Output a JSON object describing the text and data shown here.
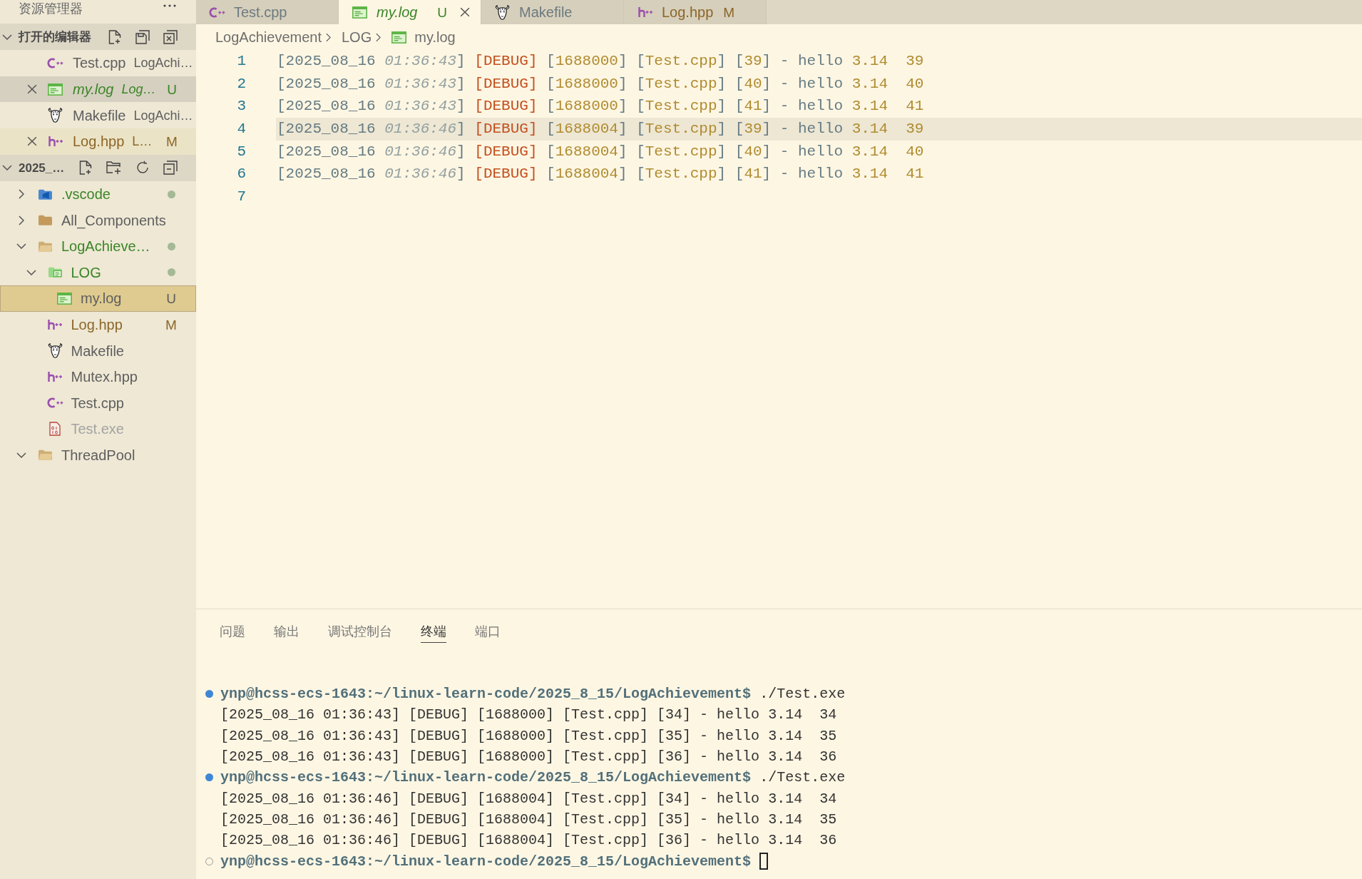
{
  "explorer": {
    "title": "资源管理器",
    "open_editors": {
      "title": "打开的编辑器",
      "expanded": true,
      "items": [
        {
          "kind": "cpp",
          "name": "Test.cpp",
          "description": "LogAchi…",
          "color": "#5e5e5e",
          "selected": false,
          "hovered": false,
          "preview": false
        },
        {
          "kind": "log",
          "name": "my.log",
          "description": "Log…",
          "badge": "U",
          "color": "#3b8527",
          "selected": true,
          "hovered": false,
          "preview": true
        },
        {
          "kind": "make",
          "name": "Makefile",
          "description": "LogAchi…",
          "color": "#5e5e5e",
          "selected": false,
          "hovered": false,
          "preview": false
        },
        {
          "kind": "hpp",
          "name": "Log.hpp",
          "description": "L…",
          "badge": "M",
          "color": "#8c6628",
          "selected": false,
          "hovered": true,
          "preview": false
        }
      ]
    },
    "folder": {
      "title": "2025_…",
      "expanded": true,
      "items": [
        {
          "kind": "vscode-folder",
          "name": ".vscode",
          "expanded": false,
          "color": "#3b8527",
          "dot": true,
          "selected": false
        },
        {
          "kind": "folder",
          "name": "All_Components",
          "expanded": false,
          "color": "#5e5e5e",
          "dot": false,
          "selected": false
        },
        {
          "kind": "folder",
          "name": "LogAchieve…",
          "expanded": true,
          "color": "#3b8527",
          "dot": true,
          "selected": false,
          "children": [
            {
              "kind": "log-folder",
              "name": "LOG",
              "expanded": true,
              "color": "#3b8527",
              "dot": true,
              "selected": false,
              "children": [
                {
                  "kind": "log",
                  "name": "my.log",
                  "badge": "U",
                  "selected": true
                }
              ]
            },
            {
              "kind": "hpp",
              "name": "Log.hpp",
              "badge": "M",
              "color": "#8c6628",
              "selected": false
            },
            {
              "kind": "make",
              "name": "Makefile",
              "color": "#5e5e5e",
              "selected": false
            },
            {
              "kind": "hpp",
              "name": "Mutex.hpp",
              "color": "#5e5e5e",
              "selected": false
            },
            {
              "kind": "cpp",
              "name": "Test.cpp",
              "color": "#5e5e5e",
              "selected": false
            },
            {
              "kind": "exe",
              "name": "Test.exe",
              "color": "#a3a3a3",
              "selected": false
            }
          ]
        },
        {
          "kind": "folder",
          "name": "ThreadPool",
          "expanded": true,
          "color": "#5e5e5e",
          "dot": false,
          "selected": false
        }
      ]
    }
  },
  "tabs": [
    {
      "kind": "cpp",
      "label": "Test.cpp",
      "color": "#6b7a80",
      "selected": false,
      "preview": false
    },
    {
      "kind": "log",
      "label": "my.log",
      "badge": "U",
      "color": "#3b8527",
      "selected": true,
      "preview": true
    },
    {
      "kind": "make",
      "label": "Makefile",
      "color": "#6b7a80",
      "selected": false,
      "preview": false
    },
    {
      "kind": "hpp",
      "label": "Log.hpp",
      "badge": "M",
      "color": "#8c6628",
      "selected": false,
      "preview": false
    }
  ],
  "breadcrumb": [
    {
      "kind": "folder",
      "label": "LogAchievement"
    },
    {
      "kind": "folder",
      "label": "LOG"
    },
    {
      "kind": "log",
      "label": "my.log"
    }
  ],
  "editor": {
    "lines": [
      {
        "number": "1",
        "current": false,
        "tokens": [
          {
            "kind": "text",
            "text": "[2025_08_16 "
          },
          {
            "kind": "time",
            "text": "01:36:43"
          },
          {
            "kind": "text",
            "text": "] "
          },
          {
            "kind": "level",
            "text": "[DEBUG]"
          },
          {
            "kind": "text",
            "text": " ["
          },
          {
            "kind": "value",
            "text": "1688000"
          },
          {
            "kind": "text",
            "text": "] ["
          },
          {
            "kind": "value",
            "text": "Test.cpp"
          },
          {
            "kind": "text",
            "text": "] ["
          },
          {
            "kind": "value",
            "text": "39"
          },
          {
            "kind": "text",
            "text": "] - hello "
          },
          {
            "kind": "value",
            "text": "3.14  39"
          }
        ]
      },
      {
        "number": "2",
        "current": false,
        "tokens": [
          {
            "kind": "text",
            "text": "[2025_08_16 "
          },
          {
            "kind": "time",
            "text": "01:36:43"
          },
          {
            "kind": "text",
            "text": "] "
          },
          {
            "kind": "level",
            "text": "[DEBUG]"
          },
          {
            "kind": "text",
            "text": " ["
          },
          {
            "kind": "value",
            "text": "1688000"
          },
          {
            "kind": "text",
            "text": "] ["
          },
          {
            "kind": "value",
            "text": "Test.cpp"
          },
          {
            "kind": "text",
            "text": "] ["
          },
          {
            "kind": "value",
            "text": "40"
          },
          {
            "kind": "text",
            "text": "] - hello "
          },
          {
            "kind": "value",
            "text": "3.14  40"
          }
        ]
      },
      {
        "number": "3",
        "current": false,
        "tokens": [
          {
            "kind": "text",
            "text": "[2025_08_16 "
          },
          {
            "kind": "time",
            "text": "01:36:43"
          },
          {
            "kind": "text",
            "text": "] "
          },
          {
            "kind": "level",
            "text": "[DEBUG]"
          },
          {
            "kind": "text",
            "text": " ["
          },
          {
            "kind": "value",
            "text": "1688000"
          },
          {
            "kind": "text",
            "text": "] ["
          },
          {
            "kind": "value",
            "text": "Test.cpp"
          },
          {
            "kind": "text",
            "text": "] ["
          },
          {
            "kind": "value",
            "text": "41"
          },
          {
            "kind": "text",
            "text": "] - hello "
          },
          {
            "kind": "value",
            "text": "3.14  41"
          }
        ]
      },
      {
        "number": "4",
        "current": true,
        "tokens": [
          {
            "kind": "text",
            "text": "[2025_08_16 "
          },
          {
            "kind": "time",
            "text": "01:36:46"
          },
          {
            "kind": "text",
            "text": "] "
          },
          {
            "kind": "level",
            "text": "[DEBUG]"
          },
          {
            "kind": "text",
            "text": " ["
          },
          {
            "kind": "value",
            "text": "1688004"
          },
          {
            "kind": "text",
            "text": "] ["
          },
          {
            "kind": "value",
            "text": "Test.cpp"
          },
          {
            "kind": "text",
            "text": "] ["
          },
          {
            "kind": "value",
            "text": "39"
          },
          {
            "kind": "text",
            "text": "] - hello "
          },
          {
            "kind": "value",
            "text": "3.14  39"
          }
        ]
      },
      {
        "number": "5",
        "current": false,
        "tokens": [
          {
            "kind": "text",
            "text": "[2025_08_16 "
          },
          {
            "kind": "time",
            "text": "01:36:46"
          },
          {
            "kind": "text",
            "text": "] "
          },
          {
            "kind": "level",
            "text": "[DEBUG]"
          },
          {
            "kind": "text",
            "text": " ["
          },
          {
            "kind": "value",
            "text": "1688004"
          },
          {
            "kind": "text",
            "text": "] ["
          },
          {
            "kind": "value",
            "text": "Test.cpp"
          },
          {
            "kind": "text",
            "text": "] ["
          },
          {
            "kind": "value",
            "text": "40"
          },
          {
            "kind": "text",
            "text": "] - hello "
          },
          {
            "kind": "value",
            "text": "3.14  40"
          }
        ]
      },
      {
        "number": "6",
        "current": false,
        "tokens": [
          {
            "kind": "text",
            "text": "[2025_08_16 "
          },
          {
            "kind": "time",
            "text": "01:36:46"
          },
          {
            "kind": "text",
            "text": "] "
          },
          {
            "kind": "level",
            "text": "[DEBUG]"
          },
          {
            "kind": "text",
            "text": " ["
          },
          {
            "kind": "value",
            "text": "1688004"
          },
          {
            "kind": "text",
            "text": "] ["
          },
          {
            "kind": "value",
            "text": "Test.cpp"
          },
          {
            "kind": "text",
            "text": "] ["
          },
          {
            "kind": "value",
            "text": "41"
          },
          {
            "kind": "text",
            "text": "] - hello "
          },
          {
            "kind": "value",
            "text": "3.14  41"
          }
        ]
      },
      {
        "number": "7",
        "current": false
      }
    ]
  },
  "panel": {
    "tabs": [
      {
        "label": "问题",
        "selected": false
      },
      {
        "label": "输出",
        "selected": false
      },
      {
        "label": "调试控制台",
        "selected": false
      },
      {
        "label": "终端",
        "selected": true
      },
      {
        "label": "端口",
        "selected": false
      }
    ],
    "terminal": {
      "lines": [
        {
          "kind": "prompt",
          "finished": true,
          "prompt": "ynp@hcss-ecs-1643:~/linux-learn-code/2025_8_15/LogAchievement$",
          "command": "./Test.exe",
          "cursor": false
        },
        {
          "kind": "output",
          "text": "[2025_08_16 01:36:43] [DEBUG] [1688000] [Test.cpp] [34] - hello 3.14  34"
        },
        {
          "kind": "output",
          "text": "[2025_08_16 01:36:43] [DEBUG] [1688000] [Test.cpp] [35] - hello 3.14  35"
        },
        {
          "kind": "output",
          "text": "[2025_08_16 01:36:43] [DEBUG] [1688000] [Test.cpp] [36] - hello 3.14  36"
        },
        {
          "kind": "prompt",
          "finished": true,
          "prompt": "ynp@hcss-ecs-1643:~/linux-learn-code/2025_8_15/LogAchievement$",
          "command": "./Test.exe",
          "cursor": false
        },
        {
          "kind": "output",
          "text": "[2025_08_16 01:36:46] [DEBUG] [1688004] [Test.cpp] [34] - hello 3.14  34"
        },
        {
          "kind": "output",
          "text": "[2025_08_16 01:36:46] [DEBUG] [1688004] [Test.cpp] [35] - hello 3.14  35"
        },
        {
          "kind": "output",
          "text": "[2025_08_16 01:36:46] [DEBUG] [1688004] [Test.cpp] [36] - hello 3.14  36"
        },
        {
          "kind": "prompt",
          "finished": false,
          "prompt": "ynp@hcss-ecs-1643:~/linux-learn-code/2025_8_15/LogAchievement$",
          "cursor": true
        }
      ]
    }
  }
}
